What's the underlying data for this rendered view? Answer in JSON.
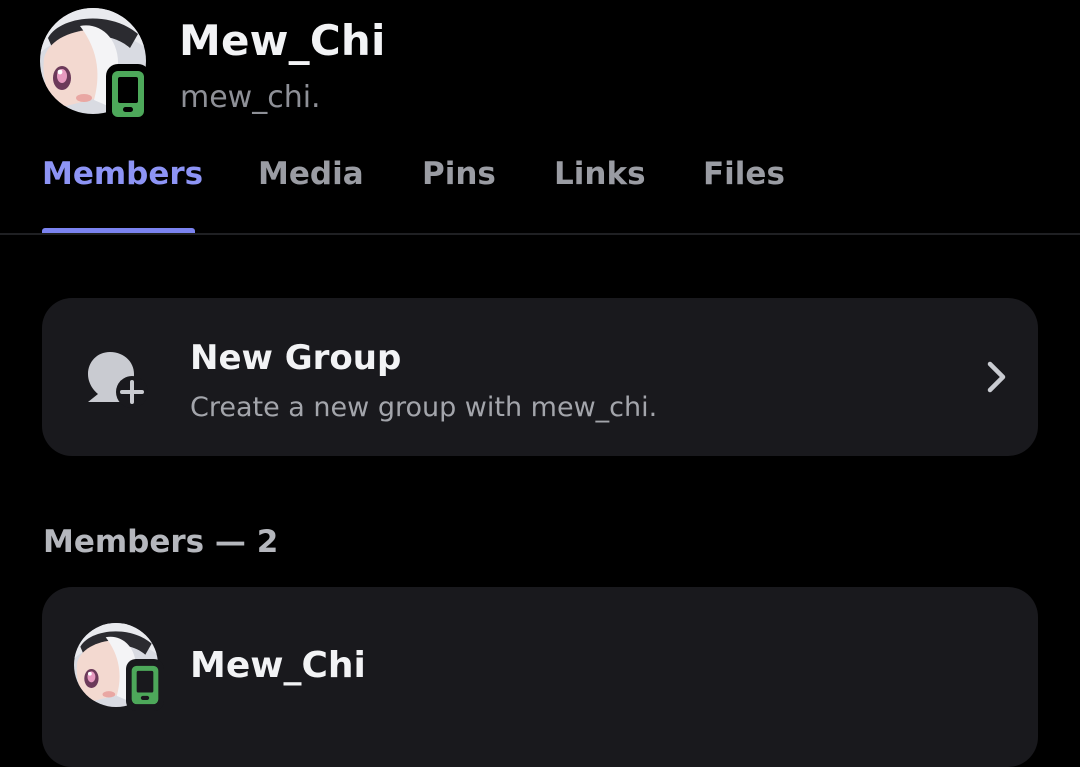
{
  "profile": {
    "display_name": "Mew_Chi",
    "username": "mew_chi.",
    "avatar_icon": "anime-avatar",
    "status_icon": "mobile-online-icon",
    "status_color": "#4da85a"
  },
  "tabs": [
    {
      "label": "Members",
      "active": true
    },
    {
      "label": "Media",
      "active": false
    },
    {
      "label": "Pins",
      "active": false
    },
    {
      "label": "Links",
      "active": false
    },
    {
      "label": "Files",
      "active": false
    }
  ],
  "accent_color": "#8d94f5",
  "new_group": {
    "title": "New Group",
    "subtitle": "Create a new group with mew_chi.",
    "icon": "new-group-icon",
    "chevron_icon": "chevron-right-icon"
  },
  "members_section": {
    "heading": "Members — 2",
    "members": [
      {
        "name": "Mew_Chi",
        "status_icon": "mobile-online-icon"
      }
    ]
  }
}
